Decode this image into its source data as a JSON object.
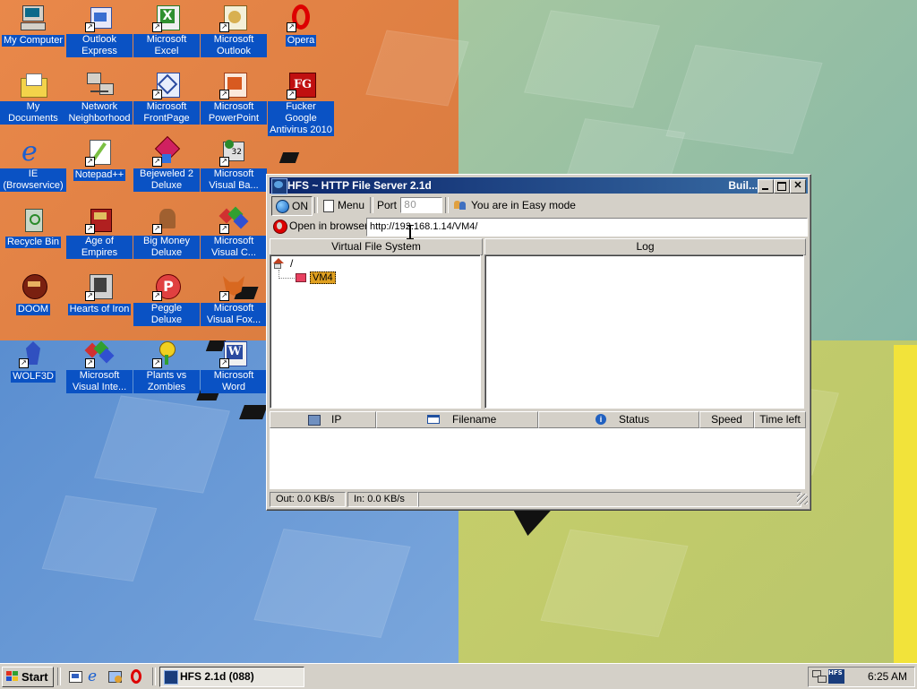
{
  "desktop": {
    "icons": [
      {
        "label": "My Computer",
        "icon": "computer-icon"
      },
      {
        "label": "Outlook Express",
        "icon": "outlook-express-icon"
      },
      {
        "label": "Microsoft Excel",
        "icon": "excel-icon"
      },
      {
        "label": "Microsoft Outlook",
        "icon": "outlook-icon"
      },
      {
        "label": "Opera",
        "icon": "opera-icon"
      },
      {
        "label": "My Documents",
        "icon": "folder-icon"
      },
      {
        "label": "Network Neighborhood",
        "icon": "network-icon"
      },
      {
        "label": "Microsoft FrontPage",
        "icon": "frontpage-icon"
      },
      {
        "label": "Microsoft PowerPoint",
        "icon": "powerpoint-icon"
      },
      {
        "label": "Fucker Google Antivirus 2010",
        "icon": "fg-antivirus-icon"
      },
      {
        "label": "IE (Browservice)",
        "icon": "internet-explorer-icon"
      },
      {
        "label": "Notepad++",
        "icon": "notepad-icon"
      },
      {
        "label": "Bejeweled 2 Deluxe",
        "icon": "bejeweled-icon"
      },
      {
        "label": "Microsoft Visual Ba...",
        "icon": "visual-basic-icon"
      },
      {
        "label": "Recycle Bin",
        "icon": "recycle-bin-icon"
      },
      {
        "label": "Age of Empires",
        "icon": "age-of-empires-icon"
      },
      {
        "label": "Big Money Deluxe",
        "icon": "big-money-icon"
      },
      {
        "label": "Microsoft Visual C...",
        "icon": "visual-c-icon"
      },
      {
        "label": "DOOM",
        "icon": "doom-icon"
      },
      {
        "label": "Hearts of Iron",
        "icon": "hearts-of-iron-icon"
      },
      {
        "label": "Peggle Deluxe",
        "icon": "peggle-icon"
      },
      {
        "label": "Microsoft Visual Fox...",
        "icon": "visual-foxpro-icon"
      },
      {
        "label": "WOLF3D",
        "icon": "wolf3d-icon"
      },
      {
        "label": "Microsoft Visual Inte...",
        "icon": "visual-interdev-icon"
      },
      {
        "label": "Plants vs Zombies",
        "icon": "plants-vs-zombies-icon"
      },
      {
        "label": "Microsoft Word",
        "icon": "word-icon"
      }
    ]
  },
  "hfs": {
    "title": "HFS ~ HTTP File Server 2.1d",
    "title_right": "Buil...",
    "toolbar": {
      "on_label": "ON",
      "menu_label": "Menu",
      "port_label": "Port",
      "port_value": "80",
      "mode_label": "You are in Easy mode"
    },
    "open_browser_label": "Open in browser",
    "url": "http://192.168.1.14/VM4/",
    "vfs_header": "Virtual File System",
    "log_header": "Log",
    "tree_root": "/",
    "tree_folder": "VM4",
    "columns": {
      "ip": "IP",
      "filename": "Filename",
      "status": "Status",
      "speed": "Speed",
      "time_left": "Time left"
    },
    "status": {
      "out": "Out: 0.0 KB/s",
      "in": "In: 0.0 KB/s"
    },
    "tray_badge": "HFS"
  },
  "taskbar": {
    "start_label": "Start",
    "task_label": "HFS 2.1d (088)",
    "clock": "6:25 AM"
  },
  "colors": {
    "title_bar": "#0a246a",
    "icon_label_bg": "#0a52c4",
    "face": "#d4d0c8"
  }
}
